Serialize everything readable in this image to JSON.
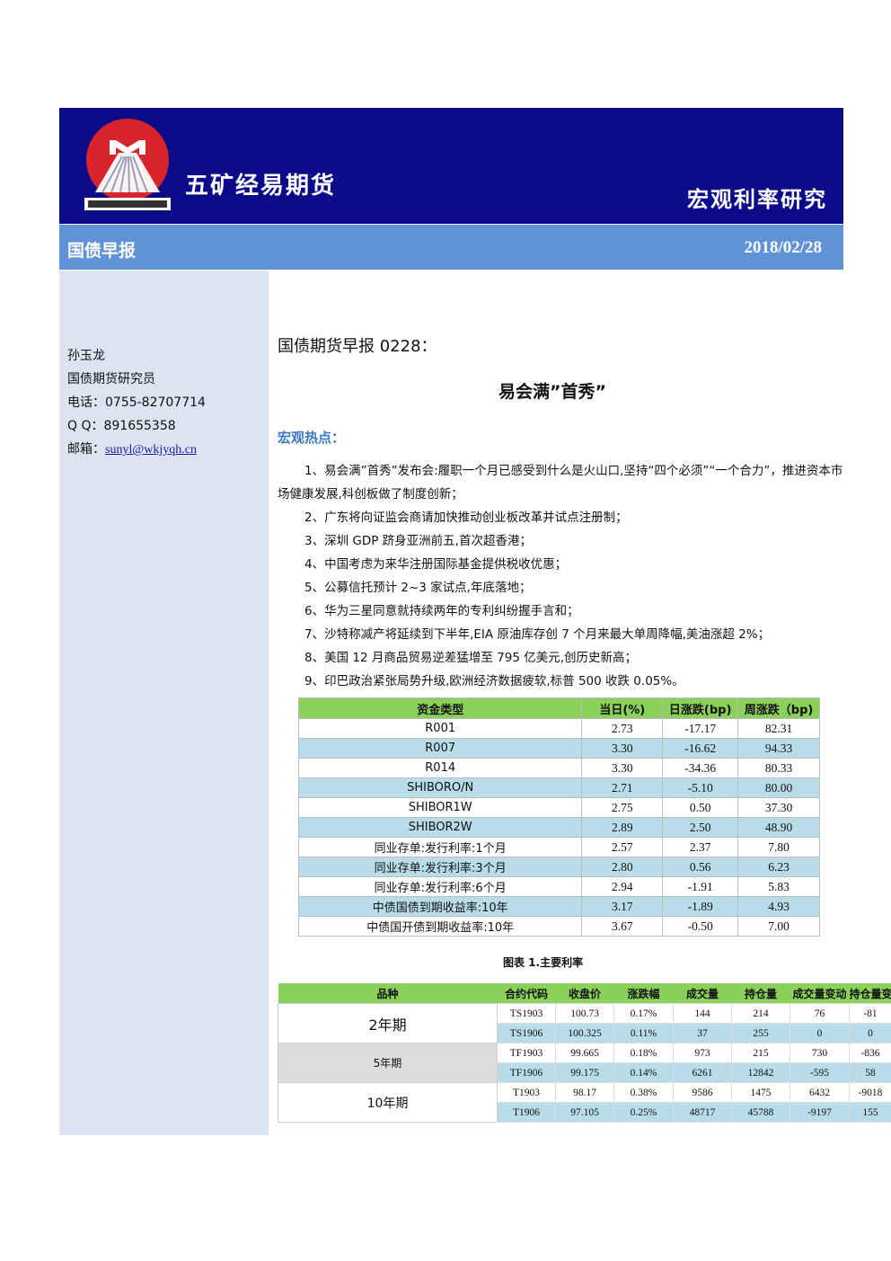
{
  "header": {
    "logo_text": "MINMETALS",
    "company": "五矿经易期货",
    "section_title": "宏观利率研究"
  },
  "subbar": {
    "report_type": "国债早报",
    "date": "2018/02/28"
  },
  "author": {
    "name": "孙玉龙",
    "title": "国债期货研究员",
    "phone": "电话：0755-82707714",
    "qq": "Q Q：891655358",
    "email_label": "邮箱：",
    "email": "sunyl@wkjyqh.cn"
  },
  "report": {
    "heading": "国债期货早报 0228：",
    "subheading": "易会满”首秀”",
    "macro_label": "宏观热点：",
    "news": [
      "1、易会满”首秀”发布会:履职一个月已感受到什么是火山口,坚持“四个必须”“一个合力”，推进资本市场健康发展,科创板做了制度创新；",
      "2、广东将向证监会商请加快推动创业板改革并试点注册制；",
      "3、深圳 GDP 跻身亚洲前五,首次超香港；",
      "4、中国考虑为来华注册国际基金提供税收优惠；",
      "5、公募信托预计 2~3 家试点,年底落地；",
      "6、华为三星同意就持续两年的专利纠纷握手言和；",
      "7、沙特称减产将延续到下半年,EIA 原油库存创 7 个月来最大单周降幅,美油涨超 2%；",
      "8、美国 12 月商品贸易逆差猛增至 795 亿美元,创历史新高；",
      "9、印巴政治紧张局势升级,欧洲经济数据疲软,标普 500 收跌 0.05%。"
    ]
  },
  "rates_table": {
    "headers": [
      "资金类型",
      "当日(%)",
      "日涨跌(bp)",
      "周涨跌（bp)"
    ],
    "rows": [
      [
        "R001",
        "2.73",
        "-17.17",
        "82.31"
      ],
      [
        "R007",
        "3.30",
        "-16.62",
        "94.33"
      ],
      [
        "R014",
        "3.30",
        "-34.36",
        "80.33"
      ],
      [
        "SHIBORO/N",
        "2.71",
        "-5.10",
        "80.00"
      ],
      [
        "SHIBOR1W",
        "2.75",
        "0.50",
        "37.30"
      ],
      [
        "SHIBOR2W",
        "2.89",
        "2.50",
        "48.90"
      ],
      [
        "同业存单:发行利率:1个月",
        "2.57",
        "2.37",
        "7.80"
      ],
      [
        "同业存单:发行利率:3个月",
        "2.80",
        "0.56",
        "6.23"
      ],
      [
        "同业存单:发行利率:6个月",
        "2.94",
        "-1.91",
        "5.83"
      ],
      [
        "中债国债到期收益率:10年",
        "3.17",
        "-1.89",
        "4.93"
      ],
      [
        "中债国开债到期收益率:10年",
        "3.67",
        "-0.50",
        "7.00"
      ]
    ],
    "caption": "图表 1.主要利率"
  },
  "futures_table": {
    "headers": [
      "品种",
      "合约代码",
      "收盘价",
      "涨跌幅",
      "成交量",
      "持仓量",
      "成交量变动",
      "持仓量变"
    ],
    "groups": [
      {
        "variety": "2年期",
        "rows": [
          [
            "TS1903",
            "100.73",
            "0.17%",
            "144",
            "214",
            "76",
            "-81"
          ],
          [
            "TS1906",
            "100.325",
            "0.11%",
            "37",
            "255",
            "0",
            "0"
          ]
        ]
      },
      {
        "variety": "5年期",
        "rows": [
          [
            "TF1903",
            "99.665",
            "0.18%",
            "973",
            "215",
            "730",
            "-836"
          ],
          [
            "TF1906",
            "99.175",
            "0.14%",
            "6261",
            "12842",
            "-595",
            "58"
          ]
        ]
      },
      {
        "variety": "10年期",
        "rows": [
          [
            "T1903",
            "98.17",
            "0.38%",
            "9586",
            "1475",
            "6432",
            "-9018"
          ],
          [
            "T1906",
            "97.105",
            "0.25%",
            "48717",
            "45788",
            "-9197",
            "155"
          ]
        ]
      }
    ]
  },
  "colors": {
    "header_bg": "#0b0b8a",
    "subbar_bg": "#5f92d6",
    "sidebar_bg": "#dce4f1",
    "table_header_green": "#8bd05a",
    "table_alt_blue": "#b8dce8",
    "macro_label_blue": "#3a78c8",
    "logo_red": "#d8242a"
  }
}
